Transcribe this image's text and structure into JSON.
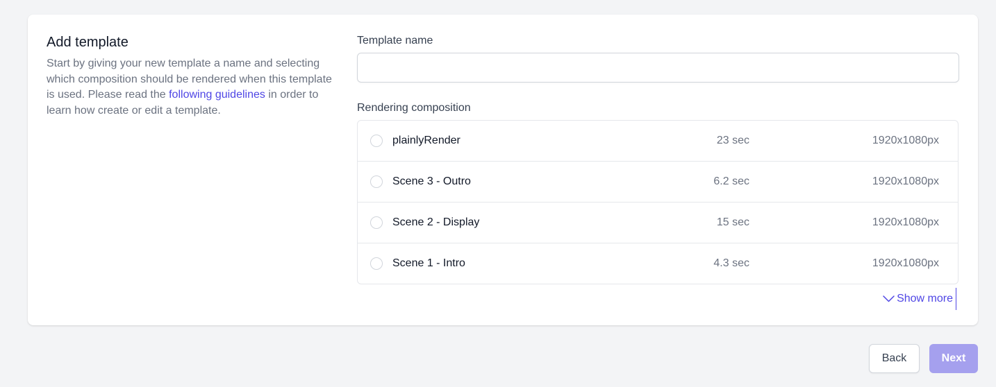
{
  "intro": {
    "title": "Add template",
    "desc_before": "Start by giving your new template a name and selecting which composition should be rendered when this template is used. Please read the ",
    "link_text": "following guidelines",
    "desc_after": " in order to learn how create or edit a template."
  },
  "form": {
    "name_label": "Template name",
    "name_value": "",
    "composition_label": "Rendering composition",
    "compositions": [
      {
        "name": "plainlyRender",
        "duration": "23 sec",
        "resolution": "1920x1080px",
        "selected": false
      },
      {
        "name": "Scene 3 - Outro",
        "duration": "6.2 sec",
        "resolution": "1920x1080px",
        "selected": false
      },
      {
        "name": "Scene 2 - Display",
        "duration": "15 sec",
        "resolution": "1920x1080px",
        "selected": false
      },
      {
        "name": "Scene 1 - Intro",
        "duration": "4.3 sec",
        "resolution": "1920x1080px",
        "selected": false
      }
    ],
    "show_more_label": "Show more",
    "show_more_icon": "chevron-down-icon"
  },
  "actions": {
    "back_label": "Back",
    "next_label": "Next",
    "next_enabled": false
  },
  "colors": {
    "accent": "#4f46e5",
    "next_disabled": "#a5a0ee",
    "background": "#f3f4f6"
  }
}
